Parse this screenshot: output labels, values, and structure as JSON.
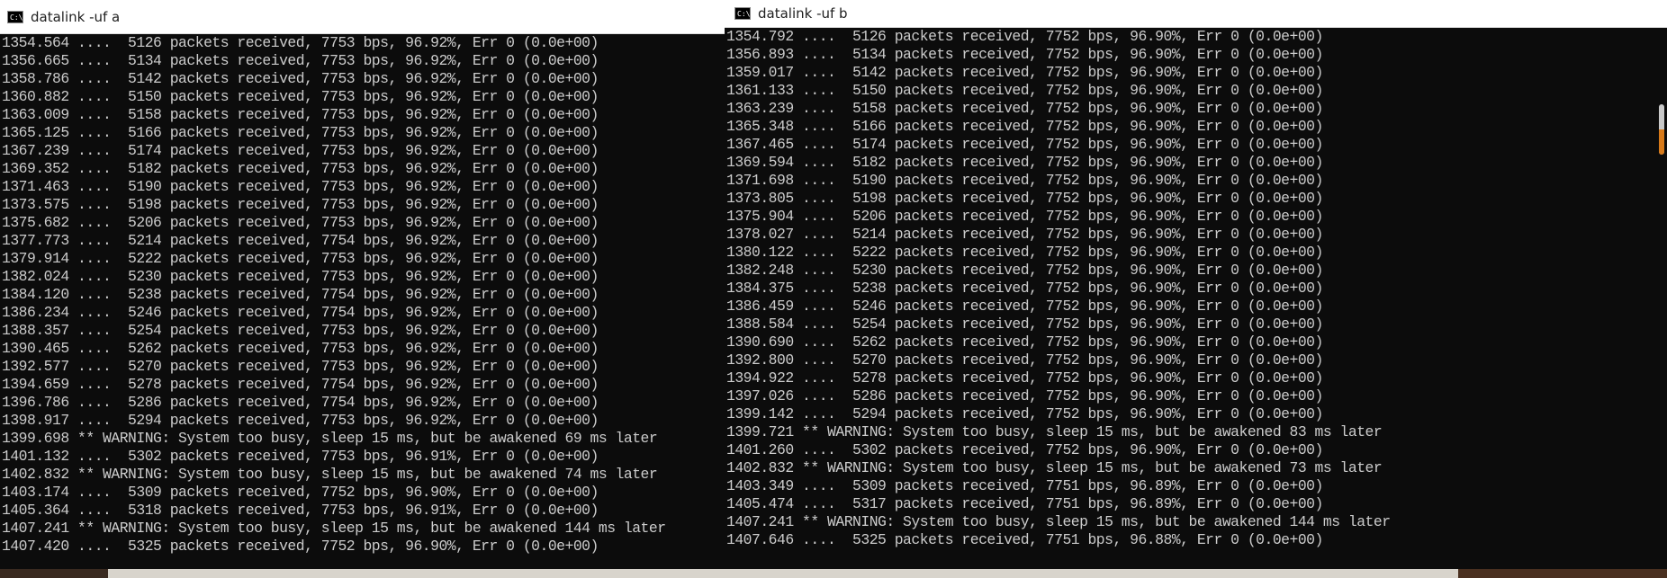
{
  "window_a": {
    "title": "datalink -uf a",
    "icon": "cmd-icon",
    "icon_text": "C:\\.",
    "lines": [
      "1354.564 ....  5126 packets received, 7753 bps, 96.92%, Err 0 (0.0e+00)",
      "1356.665 ....  5134 packets received, 7753 bps, 96.92%, Err 0 (0.0e+00)",
      "1358.786 ....  5142 packets received, 7753 bps, 96.92%, Err 0 (0.0e+00)",
      "1360.882 ....  5150 packets received, 7753 bps, 96.92%, Err 0 (0.0e+00)",
      "1363.009 ....  5158 packets received, 7753 bps, 96.92%, Err 0 (0.0e+00)",
      "1365.125 ....  5166 packets received, 7753 bps, 96.92%, Err 0 (0.0e+00)",
      "1367.239 ....  5174 packets received, 7753 bps, 96.92%, Err 0 (0.0e+00)",
      "1369.352 ....  5182 packets received, 7753 bps, 96.92%, Err 0 (0.0e+00)",
      "1371.463 ....  5190 packets received, 7753 bps, 96.92%, Err 0 (0.0e+00)",
      "1373.575 ....  5198 packets received, 7753 bps, 96.92%, Err 0 (0.0e+00)",
      "1375.682 ....  5206 packets received, 7753 bps, 96.92%, Err 0 (0.0e+00)",
      "1377.773 ....  5214 packets received, 7754 bps, 96.92%, Err 0 (0.0e+00)",
      "1379.914 ....  5222 packets received, 7753 bps, 96.92%, Err 0 (0.0e+00)",
      "1382.024 ....  5230 packets received, 7753 bps, 96.92%, Err 0 (0.0e+00)",
      "1384.120 ....  5238 packets received, 7754 bps, 96.92%, Err 0 (0.0e+00)",
      "1386.234 ....  5246 packets received, 7754 bps, 96.92%, Err 0 (0.0e+00)",
      "1388.357 ....  5254 packets received, 7753 bps, 96.92%, Err 0 (0.0e+00)",
      "1390.465 ....  5262 packets received, 7753 bps, 96.92%, Err 0 (0.0e+00)",
      "1392.577 ....  5270 packets received, 7753 bps, 96.92%, Err 0 (0.0e+00)",
      "1394.659 ....  5278 packets received, 7754 bps, 96.92%, Err 0 (0.0e+00)",
      "1396.786 ....  5286 packets received, 7754 bps, 96.92%, Err 0 (0.0e+00)",
      "1398.917 ....  5294 packets received, 7753 bps, 96.92%, Err 0 (0.0e+00)",
      "1399.698 ** WARNING: System too busy, sleep 15 ms, but be awakened 69 ms later",
      "1401.132 ....  5302 packets received, 7753 bps, 96.91%, Err 0 (0.0e+00)",
      "1402.832 ** WARNING: System too busy, sleep 15 ms, but be awakened 74 ms later",
      "1403.174 ....  5309 packets received, 7752 bps, 96.90%, Err 0 (0.0e+00)",
      "1405.364 ....  5318 packets received, 7753 bps, 96.91%, Err 0 (0.0e+00)",
      "1407.241 ** WARNING: System too busy, sleep 15 ms, but be awakened 144 ms later",
      "1407.420 ....  5325 packets received, 7752 bps, 96.90%, Err 0 (0.0e+00)"
    ]
  },
  "window_b": {
    "title": "datalink -uf b",
    "icon": "cmd-icon",
    "icon_text": "C:\\.",
    "lines": [
      "1354.792 ....  5126 packets received, 7752 bps, 96.90%, Err 0 (0.0e+00)",
      "1356.893 ....  5134 packets received, 7752 bps, 96.90%, Err 0 (0.0e+00)",
      "1359.017 ....  5142 packets received, 7752 bps, 96.90%, Err 0 (0.0e+00)",
      "1361.133 ....  5150 packets received, 7752 bps, 96.90%, Err 0 (0.0e+00)",
      "1363.239 ....  5158 packets received, 7752 bps, 96.90%, Err 0 (0.0e+00)",
      "1365.348 ....  5166 packets received, 7752 bps, 96.90%, Err 0 (0.0e+00)",
      "1367.465 ....  5174 packets received, 7752 bps, 96.90%, Err 0 (0.0e+00)",
      "1369.594 ....  5182 packets received, 7752 bps, 96.90%, Err 0 (0.0e+00)",
      "1371.698 ....  5190 packets received, 7752 bps, 96.90%, Err 0 (0.0e+00)",
      "1373.805 ....  5198 packets received, 7752 bps, 96.90%, Err 0 (0.0e+00)",
      "1375.904 ....  5206 packets received, 7752 bps, 96.90%, Err 0 (0.0e+00)",
      "1378.027 ....  5214 packets received, 7752 bps, 96.90%, Err 0 (0.0e+00)",
      "1380.122 ....  5222 packets received, 7752 bps, 96.90%, Err 0 (0.0e+00)",
      "1382.248 ....  5230 packets received, 7752 bps, 96.90%, Err 0 (0.0e+00)",
      "1384.375 ....  5238 packets received, 7752 bps, 96.90%, Err 0 (0.0e+00)",
      "1386.459 ....  5246 packets received, 7752 bps, 96.90%, Err 0 (0.0e+00)",
      "1388.584 ....  5254 packets received, 7752 bps, 96.90%, Err 0 (0.0e+00)",
      "1390.690 ....  5262 packets received, 7752 bps, 96.90%, Err 0 (0.0e+00)",
      "1392.800 ....  5270 packets received, 7752 bps, 96.90%, Err 0 (0.0e+00)",
      "1394.922 ....  5278 packets received, 7752 bps, 96.90%, Err 0 (0.0e+00)",
      "1397.026 ....  5286 packets received, 7752 bps, 96.90%, Err 0 (0.0e+00)",
      "1399.142 ....  5294 packets received, 7752 bps, 96.90%, Err 0 (0.0e+00)",
      "1399.721 ** WARNING: System too busy, sleep 15 ms, but be awakened 83 ms later",
      "1401.260 ....  5302 packets received, 7752 bps, 96.90%, Err 0 (0.0e+00)",
      "1402.832 ** WARNING: System too busy, sleep 15 ms, but be awakened 73 ms later",
      "1403.349 ....  5309 packets received, 7751 bps, 96.89%, Err 0 (0.0e+00)",
      "1405.474 ....  5317 packets received, 7751 bps, 96.89%, Err 0 (0.0e+00)",
      "1407.241 ** WARNING: System too busy, sleep 15 ms, but be awakened 144 ms later",
      "1407.646 ....  5325 packets received, 7751 bps, 96.88%, Err 0 (0.0e+00)"
    ]
  },
  "colors": {
    "console_background": "#0c0c0c",
    "console_text": "#cccccc",
    "titlebar": "#ffffff",
    "scrollbar_accent": "#d77a1a"
  }
}
